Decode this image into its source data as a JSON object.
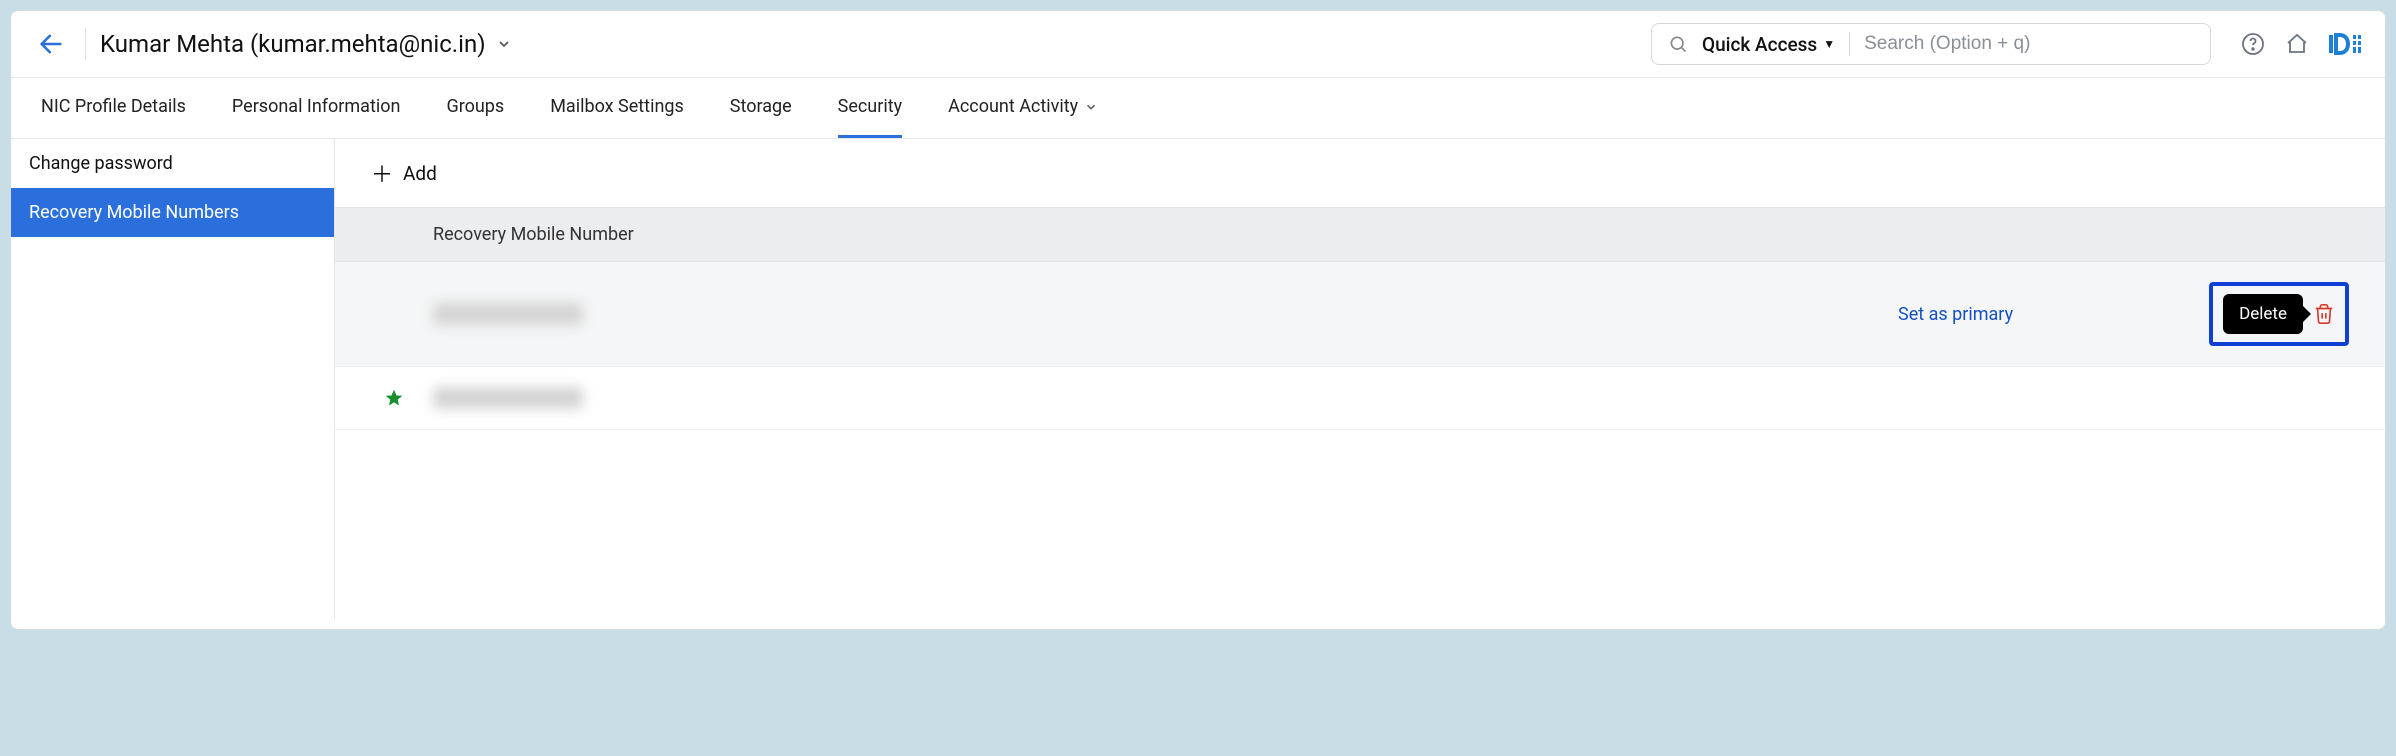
{
  "header": {
    "title": "Kumar Mehta (kumar.mehta@nic.in)",
    "quick_access_label": "Quick Access",
    "search_placeholder": "Search (Option + q)"
  },
  "tabs": [
    {
      "label": "NIC Profile Details",
      "active": false,
      "dropdown": false
    },
    {
      "label": "Personal Information",
      "active": false,
      "dropdown": false
    },
    {
      "label": "Groups",
      "active": false,
      "dropdown": false
    },
    {
      "label": "Mailbox Settings",
      "active": false,
      "dropdown": false
    },
    {
      "label": "Storage",
      "active": false,
      "dropdown": false
    },
    {
      "label": "Security",
      "active": true,
      "dropdown": false
    },
    {
      "label": "Account Activity",
      "active": false,
      "dropdown": true
    }
  ],
  "sidebar": {
    "items": [
      {
        "label": "Change password",
        "active": false
      },
      {
        "label": "Recovery Mobile Numbers",
        "active": true
      }
    ]
  },
  "content": {
    "add_label": "Add",
    "column_header": "Recovery Mobile Number",
    "set_primary_label": "Set as primary",
    "delete_tooltip": "Delete"
  }
}
